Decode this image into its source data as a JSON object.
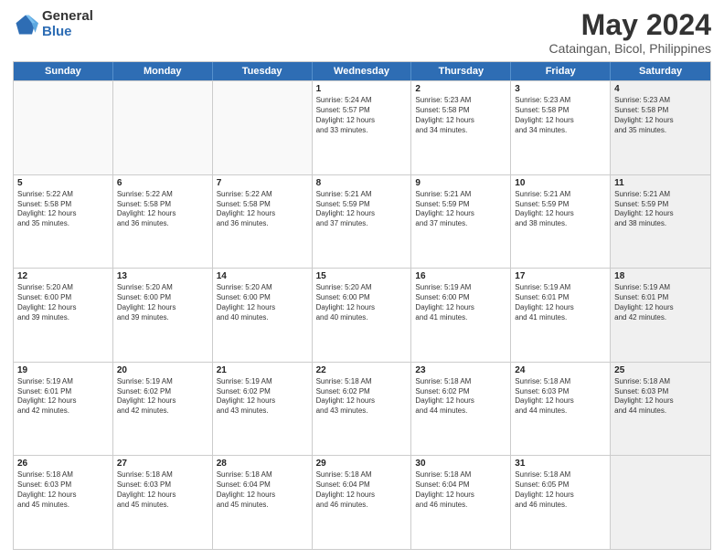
{
  "logo": {
    "general": "General",
    "blue": "Blue"
  },
  "title": "May 2024",
  "subtitle": "Cataingan, Bicol, Philippines",
  "days": [
    "Sunday",
    "Monday",
    "Tuesday",
    "Wednesday",
    "Thursday",
    "Friday",
    "Saturday"
  ],
  "rows": [
    [
      {
        "day": "",
        "text": "",
        "empty": true
      },
      {
        "day": "",
        "text": "",
        "empty": true
      },
      {
        "day": "",
        "text": "",
        "empty": true
      },
      {
        "day": "1",
        "text": "Sunrise: 5:24 AM\nSunset: 5:57 PM\nDaylight: 12 hours\nand 33 minutes."
      },
      {
        "day": "2",
        "text": "Sunrise: 5:23 AM\nSunset: 5:58 PM\nDaylight: 12 hours\nand 34 minutes."
      },
      {
        "day": "3",
        "text": "Sunrise: 5:23 AM\nSunset: 5:58 PM\nDaylight: 12 hours\nand 34 minutes."
      },
      {
        "day": "4",
        "text": "Sunrise: 5:23 AM\nSunset: 5:58 PM\nDaylight: 12 hours\nand 35 minutes.",
        "shaded": true
      }
    ],
    [
      {
        "day": "5",
        "text": "Sunrise: 5:22 AM\nSunset: 5:58 PM\nDaylight: 12 hours\nand 35 minutes."
      },
      {
        "day": "6",
        "text": "Sunrise: 5:22 AM\nSunset: 5:58 PM\nDaylight: 12 hours\nand 36 minutes."
      },
      {
        "day": "7",
        "text": "Sunrise: 5:22 AM\nSunset: 5:58 PM\nDaylight: 12 hours\nand 36 minutes."
      },
      {
        "day": "8",
        "text": "Sunrise: 5:21 AM\nSunset: 5:59 PM\nDaylight: 12 hours\nand 37 minutes."
      },
      {
        "day": "9",
        "text": "Sunrise: 5:21 AM\nSunset: 5:59 PM\nDaylight: 12 hours\nand 37 minutes."
      },
      {
        "day": "10",
        "text": "Sunrise: 5:21 AM\nSunset: 5:59 PM\nDaylight: 12 hours\nand 38 minutes."
      },
      {
        "day": "11",
        "text": "Sunrise: 5:21 AM\nSunset: 5:59 PM\nDaylight: 12 hours\nand 38 minutes.",
        "shaded": true
      }
    ],
    [
      {
        "day": "12",
        "text": "Sunrise: 5:20 AM\nSunset: 6:00 PM\nDaylight: 12 hours\nand 39 minutes."
      },
      {
        "day": "13",
        "text": "Sunrise: 5:20 AM\nSunset: 6:00 PM\nDaylight: 12 hours\nand 39 minutes."
      },
      {
        "day": "14",
        "text": "Sunrise: 5:20 AM\nSunset: 6:00 PM\nDaylight: 12 hours\nand 40 minutes."
      },
      {
        "day": "15",
        "text": "Sunrise: 5:20 AM\nSunset: 6:00 PM\nDaylight: 12 hours\nand 40 minutes."
      },
      {
        "day": "16",
        "text": "Sunrise: 5:19 AM\nSunset: 6:00 PM\nDaylight: 12 hours\nand 41 minutes."
      },
      {
        "day": "17",
        "text": "Sunrise: 5:19 AM\nSunset: 6:01 PM\nDaylight: 12 hours\nand 41 minutes."
      },
      {
        "day": "18",
        "text": "Sunrise: 5:19 AM\nSunset: 6:01 PM\nDaylight: 12 hours\nand 42 minutes.",
        "shaded": true
      }
    ],
    [
      {
        "day": "19",
        "text": "Sunrise: 5:19 AM\nSunset: 6:01 PM\nDaylight: 12 hours\nand 42 minutes."
      },
      {
        "day": "20",
        "text": "Sunrise: 5:19 AM\nSunset: 6:02 PM\nDaylight: 12 hours\nand 42 minutes."
      },
      {
        "day": "21",
        "text": "Sunrise: 5:19 AM\nSunset: 6:02 PM\nDaylight: 12 hours\nand 43 minutes."
      },
      {
        "day": "22",
        "text": "Sunrise: 5:18 AM\nSunset: 6:02 PM\nDaylight: 12 hours\nand 43 minutes."
      },
      {
        "day": "23",
        "text": "Sunrise: 5:18 AM\nSunset: 6:02 PM\nDaylight: 12 hours\nand 44 minutes."
      },
      {
        "day": "24",
        "text": "Sunrise: 5:18 AM\nSunset: 6:03 PM\nDaylight: 12 hours\nand 44 minutes."
      },
      {
        "day": "25",
        "text": "Sunrise: 5:18 AM\nSunset: 6:03 PM\nDaylight: 12 hours\nand 44 minutes.",
        "shaded": true
      }
    ],
    [
      {
        "day": "26",
        "text": "Sunrise: 5:18 AM\nSunset: 6:03 PM\nDaylight: 12 hours\nand 45 minutes."
      },
      {
        "day": "27",
        "text": "Sunrise: 5:18 AM\nSunset: 6:03 PM\nDaylight: 12 hours\nand 45 minutes."
      },
      {
        "day": "28",
        "text": "Sunrise: 5:18 AM\nSunset: 6:04 PM\nDaylight: 12 hours\nand 45 minutes."
      },
      {
        "day": "29",
        "text": "Sunrise: 5:18 AM\nSunset: 6:04 PM\nDaylight: 12 hours\nand 46 minutes."
      },
      {
        "day": "30",
        "text": "Sunrise: 5:18 AM\nSunset: 6:04 PM\nDaylight: 12 hours\nand 46 minutes."
      },
      {
        "day": "31",
        "text": "Sunrise: 5:18 AM\nSunset: 6:05 PM\nDaylight: 12 hours\nand 46 minutes."
      },
      {
        "day": "",
        "text": "",
        "empty": true,
        "shaded": true
      }
    ]
  ]
}
